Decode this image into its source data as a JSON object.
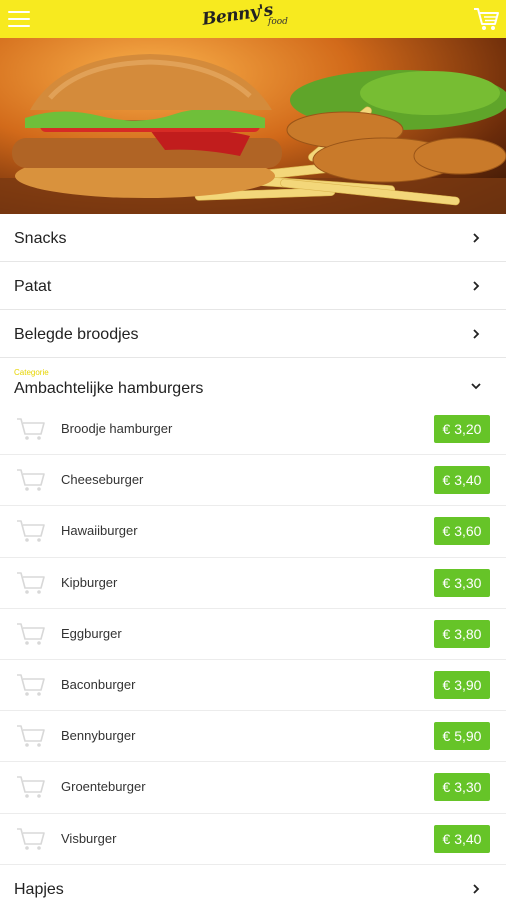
{
  "header": {
    "logo_text": "Benny's",
    "logo_subtext": "food",
    "menu_icon": "hamburger-menu-icon",
    "cart_icon": "shopping-cart-icon",
    "background_color": "#f7ea1f"
  },
  "hero": {
    "image_subject": "burger-and-fries-photo"
  },
  "categories": {
    "snacks": "Snacks",
    "patat": "Patat",
    "belegde_broodjes": "Belegde broodjes",
    "open_caption": "Categorie",
    "open_label": "Ambachtelijke hamburgers",
    "last": "Hapjes"
  },
  "items": [
    {
      "name": "Broodje hamburger",
      "price": "€ 3,20"
    },
    {
      "name": "Cheeseburger",
      "price": "€ 3,40"
    },
    {
      "name": "Hawaiiburger",
      "price": "€ 3,60"
    },
    {
      "name": "Kipburger",
      "price": "€ 3,30"
    },
    {
      "name": "Eggburger",
      "price": "€ 3,80"
    },
    {
      "name": "Baconburger",
      "price": "€ 3,90"
    },
    {
      "name": "Bennyburger",
      "price": "€ 5,90"
    },
    {
      "name": "Groenteburger",
      "price": "€ 3,30"
    },
    {
      "name": "Visburger",
      "price": "€ 3,40"
    }
  ],
  "colors": {
    "price_badge": "#66c428",
    "caption": "#e6d400"
  }
}
